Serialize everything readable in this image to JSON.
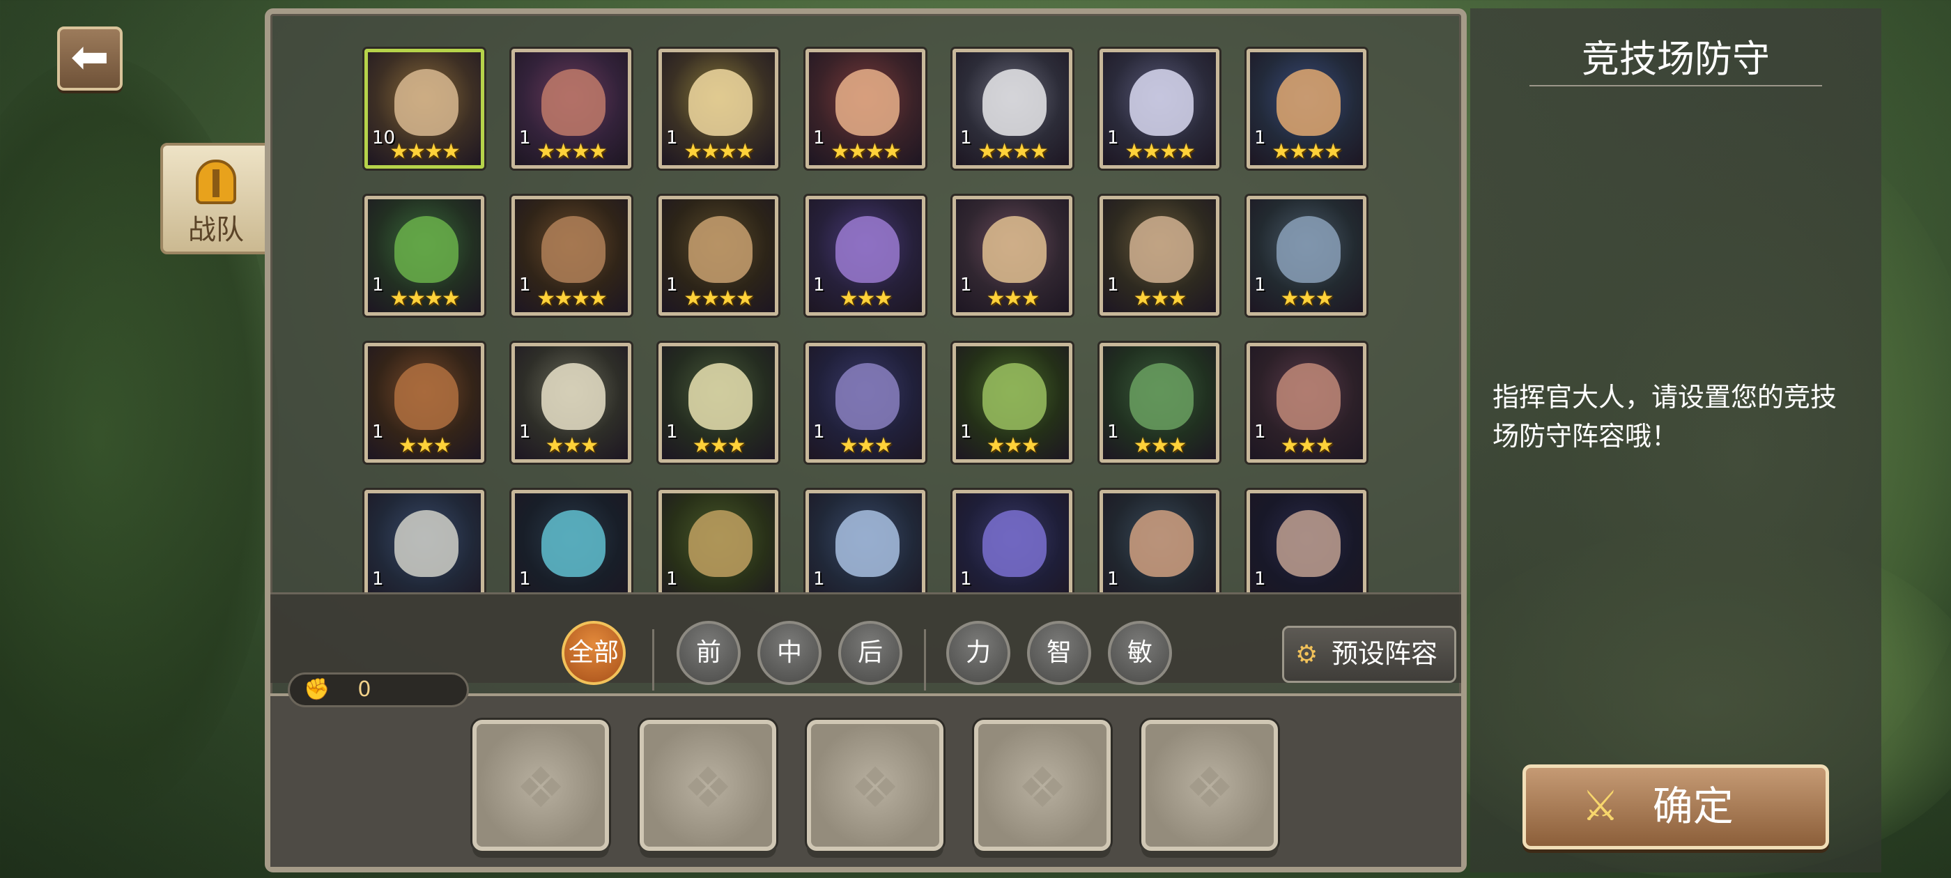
{
  "nav": {
    "back_icon": "arrow-left-icon",
    "team_tab_label": "战队"
  },
  "heroes": [
    {
      "level": "10",
      "stars": "★★★★",
      "selected": true
    },
    {
      "level": "1",
      "stars": "★★★★"
    },
    {
      "level": "1",
      "stars": "★★★★"
    },
    {
      "level": "1",
      "stars": "★★★★"
    },
    {
      "level": "1",
      "stars": "★★★★"
    },
    {
      "level": "1",
      "stars": "★★★★"
    },
    {
      "level": "1",
      "stars": "★★★★"
    },
    {
      "level": "1",
      "stars": "★★★★"
    },
    {
      "level": "1",
      "stars": "★★★★"
    },
    {
      "level": "1",
      "stars": "★★★★"
    },
    {
      "level": "1",
      "stars": "★★★"
    },
    {
      "level": "1",
      "stars": "★★★"
    },
    {
      "level": "1",
      "stars": "★★★"
    },
    {
      "level": "1",
      "stars": "★★★"
    },
    {
      "level": "1",
      "stars": "★★★"
    },
    {
      "level": "1",
      "stars": "★★★"
    },
    {
      "level": "1",
      "stars": "★★★"
    },
    {
      "level": "1",
      "stars": "★★★"
    },
    {
      "level": "1",
      "stars": "★★★"
    },
    {
      "level": "1",
      "stars": "★★★"
    },
    {
      "level": "1",
      "stars": "★★★"
    },
    {
      "level": "1",
      "stars": ""
    },
    {
      "level": "1",
      "stars": ""
    },
    {
      "level": "1",
      "stars": ""
    },
    {
      "level": "1",
      "stars": ""
    },
    {
      "level": "1",
      "stars": ""
    },
    {
      "level": "1",
      "stars": ""
    },
    {
      "level": "1",
      "stars": ""
    }
  ],
  "filters": {
    "all": "全部",
    "front": "前",
    "middle": "中",
    "back": "后",
    "strength": "力",
    "intelligence": "智",
    "agility": "敏",
    "preset_label": "预设阵容",
    "preset_icon": "gear-people-icon"
  },
  "power": {
    "icon": "fist-icon",
    "value": "0"
  },
  "slots": [
    {
      "state": "empty"
    },
    {
      "state": "empty"
    },
    {
      "state": "empty"
    },
    {
      "state": "empty"
    },
    {
      "state": "empty"
    }
  ],
  "info": {
    "title": "竞技场防守",
    "message": "指挥官大人，请设置您的竞技场防守阵容哦！"
  },
  "confirm": {
    "label": "确定",
    "icon": "crossed-swords-icon"
  }
}
